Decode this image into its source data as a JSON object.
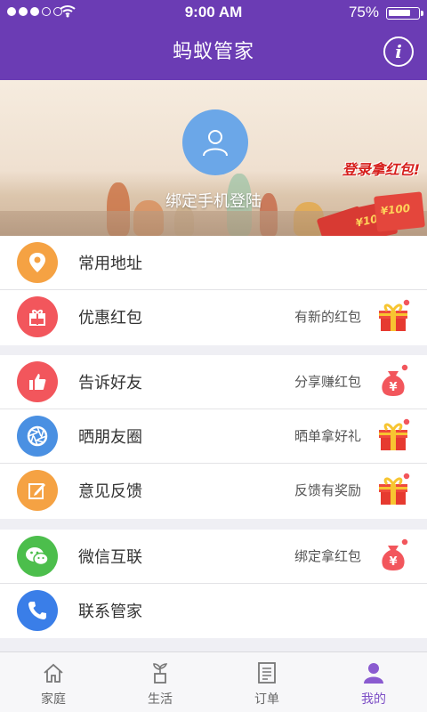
{
  "status_bar": {
    "time": "9:00 AM",
    "battery": "75%",
    "battery_level": 0.75
  },
  "header": {
    "title": "蚂蚁管家",
    "info_icon": "info-icon",
    "info_glyph": "i"
  },
  "banner": {
    "login_text": "绑定手机登陆",
    "promo_text": "登录拿红包!",
    "envelope_values": [
      "¥10",
      "¥100"
    ]
  },
  "groups": [
    {
      "rows": [
        {
          "label": "常用地址",
          "icon": "location-pin-icon",
          "color": "#f5a243",
          "hint": "",
          "badge": ""
        },
        {
          "label": "优惠红包",
          "icon": "gift-icon",
          "color": "#f2565c",
          "hint": "有新的红包",
          "badge": "gift-box-icon"
        }
      ]
    },
    {
      "rows": [
        {
          "label": "告诉好友",
          "icon": "thumbs-up-icon",
          "color": "#f2565c",
          "hint": "分享赚红包",
          "badge": "money-bag-icon"
        },
        {
          "label": "晒朋友圈",
          "icon": "aperture-icon",
          "color": "#4a90e2",
          "hint": "晒单拿好礼",
          "badge": "gift-box-icon"
        },
        {
          "label": "意见反馈",
          "icon": "edit-icon",
          "color": "#f5a243",
          "hint": "反馈有奖励",
          "badge": "gift-box-icon"
        }
      ]
    },
    {
      "rows": [
        {
          "label": "微信互联",
          "icon": "wechat-icon",
          "color": "#4cbe4c",
          "hint": "绑定拿红包",
          "badge": "money-bag-icon"
        },
        {
          "label": "联系管家",
          "icon": "phone-icon",
          "color": "#3a7ee8",
          "hint": "",
          "badge": ""
        }
      ]
    }
  ],
  "tabs": [
    {
      "label": "家庭",
      "icon": "home-icon",
      "active": false
    },
    {
      "label": "生活",
      "icon": "sprout-icon",
      "active": false
    },
    {
      "label": "订单",
      "icon": "document-icon",
      "active": false
    },
    {
      "label": "我的",
      "icon": "user-icon",
      "active": true
    }
  ],
  "colors": {
    "header": "#6b3cb4",
    "active_tab": "#7d4fc6",
    "badge_dot": "#f2565c"
  }
}
